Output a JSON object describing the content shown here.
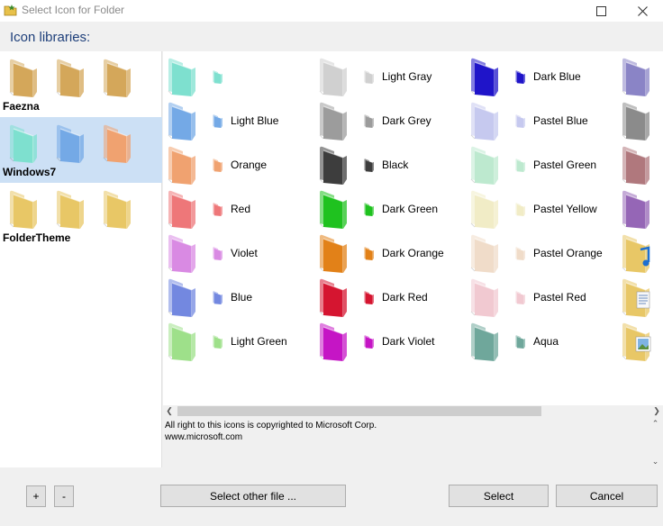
{
  "window": {
    "title": "Select Icon for Folder",
    "icon": "folder-star-icon",
    "controls": {
      "maximize": "maximize-icon",
      "close": "close-icon"
    }
  },
  "header": {
    "label": "Icon libraries:"
  },
  "libraries": [
    {
      "name": "Faezna",
      "selected": false,
      "thumbs": [
        "folder-tan-icon",
        "folder-tan-icon",
        "folder-document-icon"
      ]
    },
    {
      "name": "Windows7",
      "selected": true,
      "thumbs": [
        "folder-aqua-icon",
        "folder-blue-icon",
        "folder-orange-icon"
      ]
    },
    {
      "name": "FolderTheme",
      "selected": false,
      "thumbs": [
        "folder-paint-icon",
        "folder-media-icon",
        "folder-brick-icon"
      ]
    }
  ],
  "icons": {
    "columns": [
      [
        {
          "label": "",
          "color": "#7ee0cf"
        },
        {
          "label": "Light Blue",
          "color": "#74a9e6"
        },
        {
          "label": "Orange",
          "color": "#f0a270"
        },
        {
          "label": "Red",
          "color": "#ee7779"
        },
        {
          "label": "Violet",
          "color": "#d98ae3"
        },
        {
          "label": "Blue",
          "color": "#7388e0"
        },
        {
          "label": "Light Green",
          "color": "#9ee08a"
        }
      ],
      [
        {
          "label": "Light Gray",
          "color": "#d0d0d0"
        },
        {
          "label": "Dark Grey",
          "color": "#9c9c9c"
        },
        {
          "label": "Black",
          "color": "#3d3d3d"
        },
        {
          "label": "Dark Green",
          "color": "#1fc21f"
        },
        {
          "label": "Dark Orange",
          "color": "#e28118"
        },
        {
          "label": "Dark Red",
          "color": "#d51530"
        },
        {
          "label": "Dark Violet",
          "color": "#c515c5"
        }
      ],
      [
        {
          "label": "Dark Blue",
          "color": "#1f14c9"
        },
        {
          "label": "Pastel Blue",
          "color": "#c6c9ef"
        },
        {
          "label": "Pastel Green",
          "color": "#bde9cf"
        },
        {
          "label": "Pastel Yellow",
          "color": "#f1ecc6"
        },
        {
          "label": "Pastel Orange",
          "color": "#f0dcc9"
        },
        {
          "label": "Pastel Red",
          "color": "#f1c9d1"
        },
        {
          "label": "Aqua",
          "color": "#6fa79b"
        }
      ],
      [
        {
          "label": "",
          "color": "#8a84c6"
        },
        {
          "label": "",
          "color": "#8b8b8b"
        },
        {
          "label": "",
          "color": "#b0787d"
        },
        {
          "label": "",
          "color": "#9566b6"
        },
        {
          "label": "",
          "color": "#e8c766",
          "badge": "music-note-icon"
        },
        {
          "label": "",
          "color": "#e8c766",
          "badge": "document-icon"
        },
        {
          "label": "",
          "color": "#e8c766",
          "badge": "picture-icon"
        }
      ]
    ]
  },
  "copyright": {
    "line1": "All right to this icons is copyrighted to Microsoft Corp.",
    "line2": "www.microsoft.com"
  },
  "footer": {
    "add": "+",
    "remove": "-",
    "select_other": "Select other file ...",
    "select": "Select",
    "cancel": "Cancel"
  }
}
